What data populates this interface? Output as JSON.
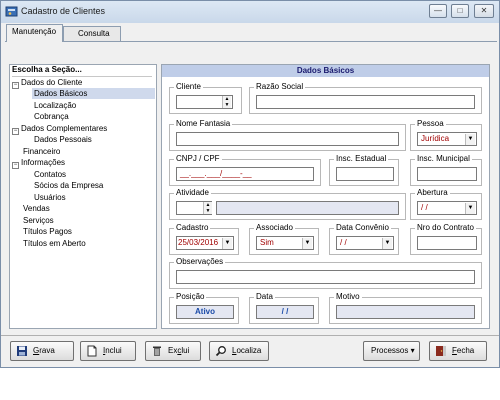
{
  "window": {
    "title": "Cadastro de Clientes",
    "min_label": "—",
    "max_label": "□",
    "close_label": "✕"
  },
  "tabs": [
    {
      "label": "Manutenção"
    },
    {
      "label": "Consulta"
    }
  ],
  "left": {
    "header": "Escolha a Seção...",
    "tree": [
      {
        "label": "Dados do Cliente",
        "expander": "⊟"
      },
      {
        "label": "Dados Básicos"
      },
      {
        "label": "Localização"
      },
      {
        "label": "Cobrança"
      },
      {
        "label": "Dados Complementares",
        "expander": "⊟"
      },
      {
        "label": "Dados Pessoais"
      },
      {
        "label": "Financeiro"
      },
      {
        "label": "Informações",
        "expander": "⊟"
      },
      {
        "label": "Contatos"
      },
      {
        "label": "Sócios da Empresa"
      },
      {
        "label": "Usuários"
      },
      {
        "label": "Vendas"
      },
      {
        "label": "Serviços"
      },
      {
        "label": "Títulos Pagos"
      },
      {
        "label": "Títulos em Aberto"
      }
    ]
  },
  "main": {
    "section_title": "Dados Básicos",
    "cliente": {
      "label": "Cliente",
      "value": ""
    },
    "razao_social": {
      "label": "Razão Social",
      "value": ""
    },
    "nome_fantasia": {
      "label": "Nome Fantasia",
      "value": ""
    },
    "pessoa": {
      "label": "Pessoa",
      "value": "Jurídica"
    },
    "cnpj": {
      "label": "CNPJ / CPF",
      "value": "__.___.___/____-__"
    },
    "insc_estadual": {
      "label": "Insc. Estadual",
      "value": ""
    },
    "insc_municipal": {
      "label": "Insc. Municipal",
      "value": ""
    },
    "atividade": {
      "label": "Atividade",
      "value": ""
    },
    "abertura": {
      "label": "Abertura",
      "value": "/ /"
    },
    "cadastro": {
      "label": "Cadastro",
      "value": "25/03/2016"
    },
    "associado": {
      "label": "Associado",
      "value": "Sim"
    },
    "data_convenio": {
      "label": "Data Convênio",
      "value": "/ /"
    },
    "nro_contrato": {
      "label": "Nro do Contrato",
      "value": ""
    },
    "observacoes": {
      "label": "Observações",
      "value": ""
    },
    "posicao": {
      "label": "Posição",
      "value": "Ativo"
    },
    "data": {
      "label": "Data",
      "value": "/ /"
    },
    "motivo": {
      "label": "Motivo",
      "value": ""
    }
  },
  "buttons": {
    "grava": {
      "first": "G",
      "rest": "rava",
      "icon": "floppy-icon"
    },
    "inclui": {
      "first": "I",
      "rest": "nclui",
      "icon": "new-document-icon"
    },
    "exclui": {
      "first": "Ex",
      "u": "c",
      "rest": "lui",
      "icon": "trash-icon"
    },
    "localiza": {
      "first": "",
      "u": "L",
      "rest": "ocaliza",
      "icon": "magnifier-icon"
    },
    "processos": {
      "label": "Processos ▾"
    },
    "fecha": {
      "first": "",
      "u": "F",
      "rest": "echa",
      "icon": "exit-door-icon"
    }
  }
}
